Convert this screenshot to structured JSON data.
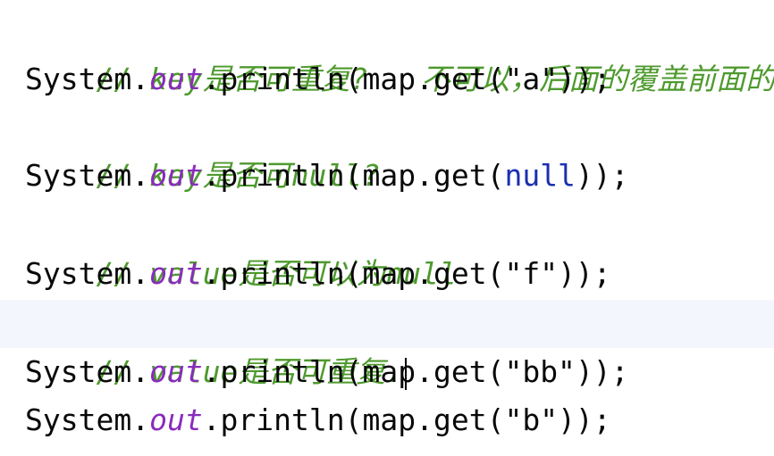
{
  "editor": {
    "colors": {
      "background": "#ffffff",
      "current_line": "#f3f6fc",
      "comment": "#4e9a2e",
      "field": "#8a2bbd",
      "keyword": "#1a2fb0",
      "text": "#080808"
    },
    "lines": [
      {
        "comment": "// key是否可重复?   不可以，后面的覆盖前面的"
      },
      {
        "prefix": "System.",
        "field": "out",
        "middle": ".println(map.get(",
        "arg": "\"a\"",
        "suffix": "));"
      },
      {
        "comment": "// key是否可null?"
      },
      {
        "prefix": "System.",
        "field": "out",
        "middle": ".println(map.get(",
        "arg": "null",
        "suffix": "));"
      },
      {
        "comment": "// value是否可以为null"
      },
      {
        "prefix": "System.",
        "field": "out",
        "middle": ".println(map.get(",
        "arg": "\"f\"",
        "suffix": "));"
      },
      {
        "comment": "// value是否可重复."
      },
      {
        "prefix": "System.",
        "field": "out",
        "middle": ".println(map.get(",
        "arg": "\"bb\"",
        "suffix": "));"
      },
      {
        "prefix": "System.",
        "field": "out",
        "middle": ".println(map.get(",
        "arg": "\"b\"",
        "suffix": "));"
      }
    ]
  }
}
